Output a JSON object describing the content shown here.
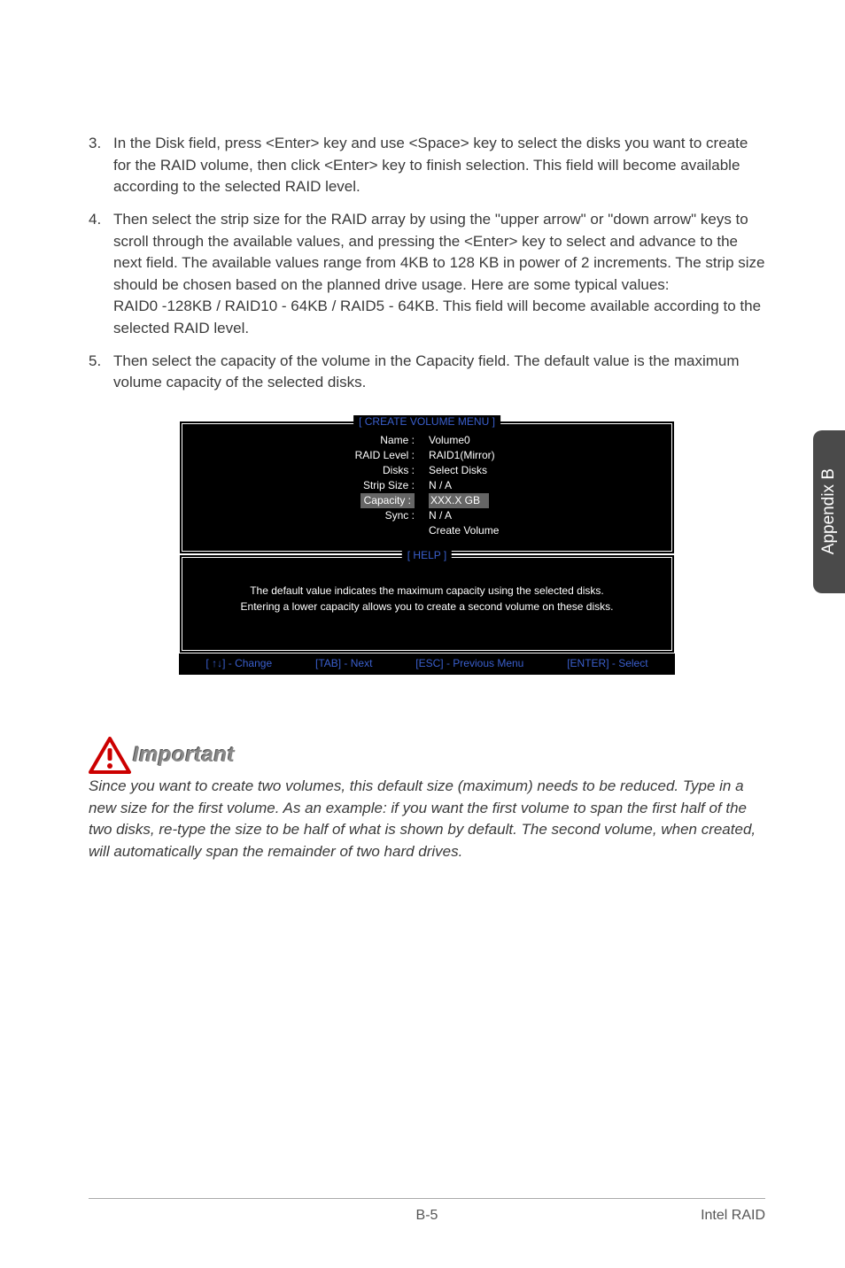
{
  "list": {
    "item3": {
      "num": "3.",
      "text": "In the Disk field, press <Enter> key and use <Space> key to select the disks you want to create for the RAID volume, then click <Enter> key to finish selection. This field will become available according to the selected RAID level."
    },
    "item4": {
      "num": "4.",
      "text": "Then select the strip size for the RAID array by using the \"upper arrow\" or \"down arrow\" keys to scroll through the available values, and pressing the <Enter> key to select and advance to the next field. The available values range from 4KB to 128 KB in power of 2 increments. The strip size should be chosen based on the planned drive usage. Here are some typical values:\nRAID0 -128KB / RAID10 - 64KB / RAID5 - 64KB. This field will become available according to the selected RAID level."
    },
    "item5": {
      "num": "5.",
      "text": "Then select the capacity of the volume in the Capacity field. The default value is the maximum volume capacity of the selected disks."
    }
  },
  "bios": {
    "createTitle": "[  CREATE VOLUME MENU  ]",
    "labels": {
      "name": "Name :",
      "raidLevel": "RAID Level :",
      "disks": "Disks :",
      "stripSize": "Strip Size :",
      "capacity": "Capacity :",
      "sync": "Sync :"
    },
    "values": {
      "name": "Volume0",
      "raidLevel": "RAID1(Mirror)",
      "disks": "Select  Disks",
      "stripSize": "N / A",
      "capacity": "XXX.X  GB",
      "sync": "N / A",
      "createVolume": "Create Volume"
    },
    "helpTitle": "[   HELP   ]",
    "helpText": "The default value indicates the maximum capacity using the selected disks. Entering a lower capacity allows you to create a second volume  on  these  disks.",
    "footer": {
      "change": "[ ↑↓] - Change",
      "tab": "[TAB] - Next",
      "esc": "[ESC] - Previous Menu",
      "enter": "[ENTER] - Select"
    }
  },
  "important": {
    "label": "Important",
    "text": "Since you want to create two volumes, this default size (maximum) needs to be reduced. Type in a new size for the first volume. As an example: if you want the first volume to span the first half of the two disks, re-type the size to be half of what is shown by default. The second volume, when created, will automatically span the remainder of two hard drives."
  },
  "sideTab": "Appendix B",
  "footer": {
    "page": "B-5",
    "section": "Intel RAID"
  }
}
